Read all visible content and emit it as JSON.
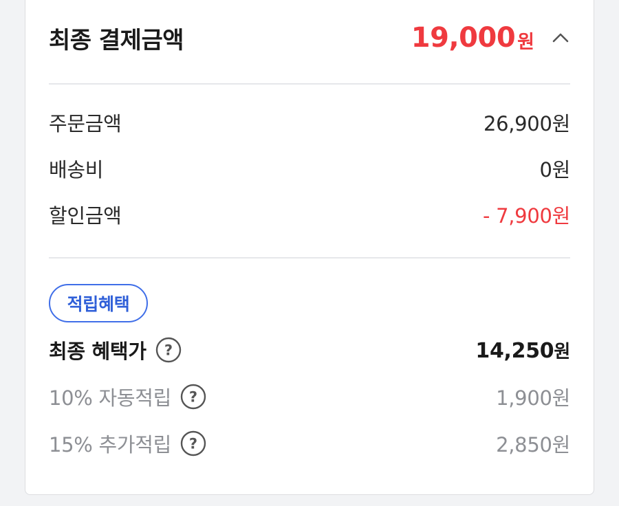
{
  "summary": {
    "title": "최종 결제금액",
    "total_amount": "19,000",
    "unit": "원"
  },
  "breakdown": [
    {
      "label": "주문금액",
      "value": "26,900원"
    },
    {
      "label": "배송비",
      "value": "0원"
    },
    {
      "label": "할인금액",
      "value": "- 7,900원"
    }
  ],
  "rewards": {
    "badge": "적립혜택",
    "final_benefit": {
      "label": "최종 혜택가",
      "amount": "14,250",
      "unit": "원"
    },
    "auto": {
      "label": "10% 자동적립",
      "value": "1,900원"
    },
    "extra": {
      "label": "15% 추가적립",
      "value": "2,850원"
    }
  },
  "colors": {
    "accent_red": "#ef3a3f",
    "badge_blue": "#3f6ee8",
    "muted_grey": "#8d8f94"
  }
}
